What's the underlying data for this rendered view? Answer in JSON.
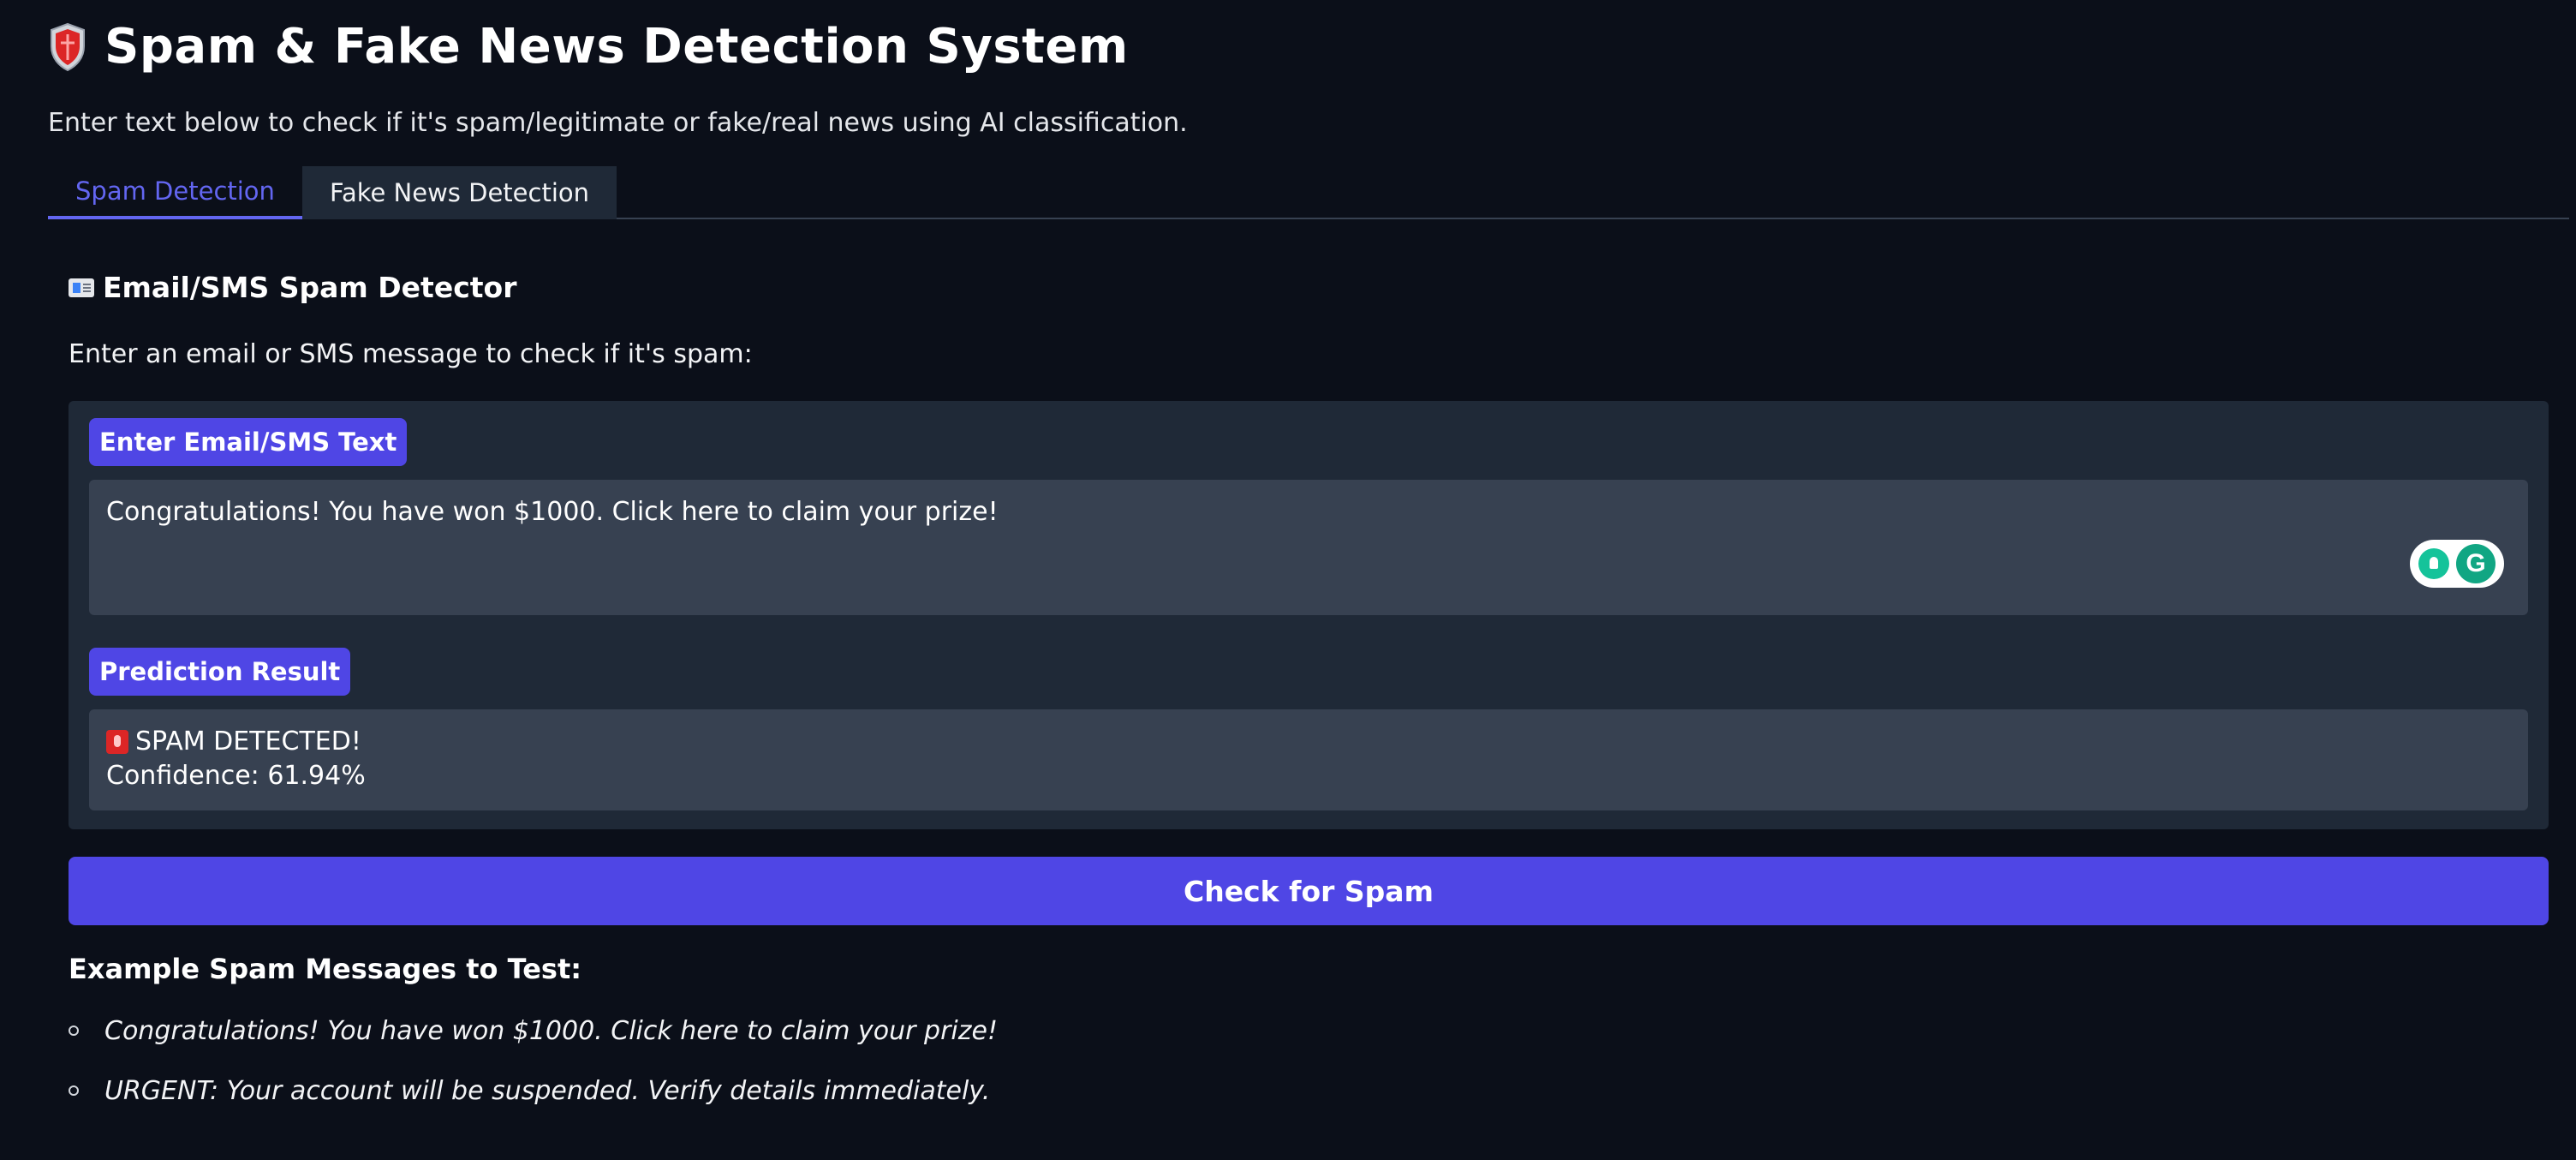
{
  "header": {
    "title": "Spam & Fake News Detection System",
    "subtitle": "Enter text below to check if it's spam/legitimate or fake/real news using AI classification.",
    "icon": "shield-icon"
  },
  "tabs": [
    {
      "label": "Spam Detection",
      "active": true
    },
    {
      "label": "Fake News Detection",
      "active": false
    }
  ],
  "spam": {
    "section_title": "Email/SMS Spam Detector",
    "section_icon": "mail-icon",
    "instructions": "Enter an email or SMS message to check if it's spam:",
    "input_label": "Enter Email/SMS Text",
    "input_value": "Congratulations! You have won $1000. Click here to claim your prize!",
    "result_label": "Prediction Result",
    "result_line1": "SPAM DETECTED!",
    "result_icon": "siren-icon",
    "result_line2": "Confidence: 61.94%",
    "button_label": "Check for Spam",
    "examples_title": "Example Spam Messages to Test:",
    "examples": [
      "Congratulations! You have won $1000. Click here to claim your prize!",
      "URGENT: Your account will be suspended. Verify details immediately."
    ]
  },
  "colors": {
    "background": "#0b0f19",
    "panel": "#1f2937",
    "field": "#374151",
    "accent": "#4f46e5",
    "active_tab": "#6366f1"
  }
}
